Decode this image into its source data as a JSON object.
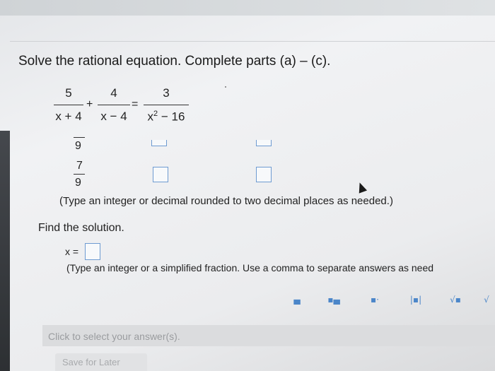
{
  "question": {
    "title": "Solve the rational equation. Complete parts (a) – (c)."
  },
  "equation": {
    "term1": {
      "num": "5",
      "den": "x + 4"
    },
    "plus": "+",
    "term2": {
      "num": "4",
      "den": "x − 4"
    },
    "equals": "=",
    "term3": {
      "num": "3",
      "den_base": "x",
      "den_exp": "2",
      "den_rest": " − 16"
    }
  },
  "partial_rows": {
    "row1": {
      "digit": "9"
    },
    "row2": {
      "num": "7",
      "den": "9"
    }
  },
  "instructions": {
    "rounding_note": "(Type an integer or decimal rounded to two decimal places as needed.)",
    "find_solution": "Find the solution.",
    "x_label": "x =",
    "fraction_note": "(Type an integer or a simplified fraction. Use a comma to separate answers as need"
  },
  "toolbar": {
    "icons": [
      "fraction-icon",
      "mixed-number-icon",
      "exponent-icon",
      "absolute-value-icon",
      "square-root-icon",
      "nth-root-icon"
    ],
    "labels": [
      "▄",
      "▪▄",
      "▪·",
      "|▪|",
      "√▪",
      "√"
    ]
  },
  "footer": {
    "click_text": "Click to select your answer(s).",
    "save_label": "Save for Later"
  },
  "colors": {
    "box_border": "#6e9bd1",
    "tool_icon": "#4b86c9",
    "text": "#222222"
  }
}
